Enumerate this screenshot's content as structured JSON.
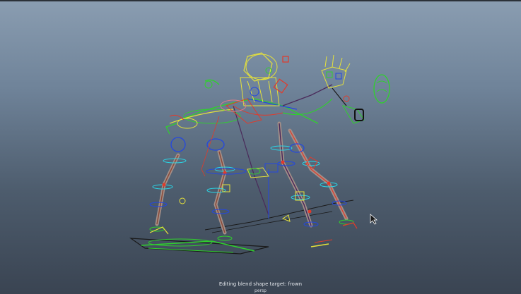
{
  "viewport": {
    "status_message": "Editing blend shape target: frown",
    "camera_label": "persp"
  },
  "colors": {
    "bg_top": "#8a9db1",
    "bg_bottom": "#3a4452",
    "rig_yellow": "#e6e23a",
    "rig_green": "#2fd12c",
    "rig_blue": "#2447e0",
    "rig_cyan": "#29d6e6",
    "rig_red": "#e23a2a",
    "rig_pink": "#e07b8a",
    "bone_gray": "#a38f88"
  }
}
